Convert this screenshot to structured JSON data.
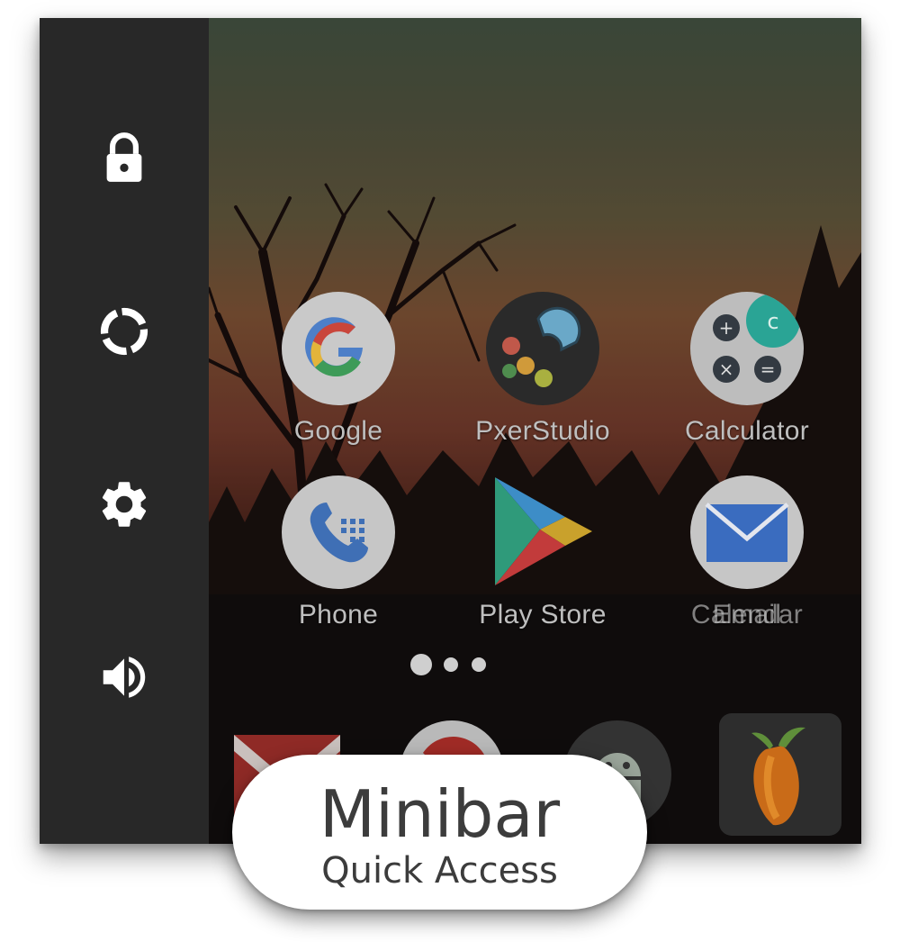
{
  "sidebar": {
    "buttons": [
      {
        "icon": "lock-icon"
      },
      {
        "icon": "recents-circle-icon"
      },
      {
        "icon": "gear-icon"
      },
      {
        "icon": "volume-icon"
      }
    ]
  },
  "home": {
    "apps": [
      {
        "label": "Google",
        "icon": "google-icon"
      },
      {
        "label": "PxerStudio",
        "icon": "pxerstudio-icon"
      },
      {
        "label": "Calculator",
        "icon": "calculator-icon"
      },
      {
        "label": "Phone",
        "icon": "phone-icon"
      },
      {
        "label": "Play Store",
        "icon": "play-store-icon"
      },
      {
        "label": "Calendar",
        "icon": "calendar-icon"
      },
      {
        "label": "Email",
        "icon": "email-icon"
      }
    ],
    "page_indicator": {
      "pages": 3,
      "current": 1
    },
    "dock": [
      {
        "icon": "gmail-icon"
      },
      {
        "icon": "chrome-icon"
      },
      {
        "icon": "android-icon"
      },
      {
        "icon": "fl-studio-icon"
      }
    ]
  },
  "banner": {
    "title": "Minibar",
    "subtitle": "Quick Access"
  },
  "colors": {
    "sidebar": "#282828",
    "banner_bg": "#ffffff",
    "banner_text": "#3c3c3c",
    "label_text": "#bfbfbf"
  }
}
